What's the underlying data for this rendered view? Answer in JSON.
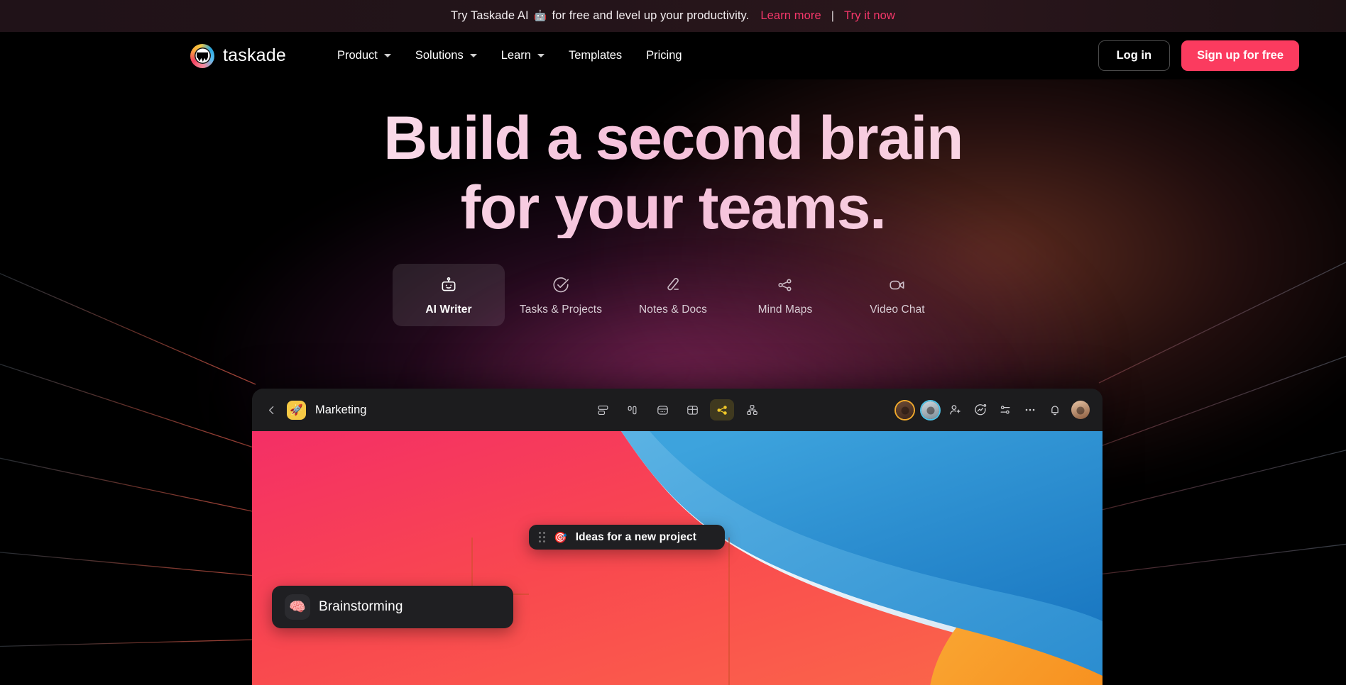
{
  "banner": {
    "text_before": "Try Taskade AI",
    "emoji": "🤖",
    "text_after": "for free and level up your productivity.",
    "learn_more": "Learn more",
    "separator": "|",
    "try_now": "Try it now",
    "link_color": "#f5376a"
  },
  "nav": {
    "brand": "taskade",
    "links": [
      {
        "label": "Product",
        "has_caret": true
      },
      {
        "label": "Solutions",
        "has_caret": true
      },
      {
        "label": "Learn",
        "has_caret": true
      },
      {
        "label": "Templates",
        "has_caret": false
      },
      {
        "label": "Pricing",
        "has_caret": false
      }
    ],
    "login_label": "Log in",
    "signup_label": "Sign up for free",
    "signup_color": "#fb3b5f"
  },
  "hero": {
    "headline_line1": "Build a second brain",
    "headline_line2": "for your teams.",
    "tabs": [
      {
        "label": "AI Writer",
        "icon": "robot-icon",
        "active": true
      },
      {
        "label": "Tasks & Projects",
        "icon": "check-circle-icon",
        "active": false
      },
      {
        "label": "Notes & Docs",
        "icon": "pen-icon",
        "active": false
      },
      {
        "label": "Mind Maps",
        "icon": "share-nodes-icon",
        "active": false
      },
      {
        "label": "Video Chat",
        "icon": "video-camera-icon",
        "active": false
      }
    ]
  },
  "app": {
    "project_emoji": "🚀",
    "project_name": "Marketing",
    "view_buttons": [
      {
        "name": "list-view",
        "active": false
      },
      {
        "name": "board-view",
        "active": false
      },
      {
        "name": "action-view",
        "active": false
      },
      {
        "name": "table-view",
        "active": false
      },
      {
        "name": "mindmap-view",
        "active": true
      },
      {
        "name": "org-chart-view",
        "active": false
      }
    ],
    "active_view_color": "#f0c828",
    "right_actions": [
      {
        "name": "collaborator-avatar-1"
      },
      {
        "name": "collaborator-avatar-2"
      },
      {
        "name": "invite-user-icon"
      },
      {
        "name": "activity-icon"
      },
      {
        "name": "filter-icon"
      },
      {
        "name": "more-options-icon"
      },
      {
        "name": "notifications-bell-icon"
      },
      {
        "name": "account-avatar"
      }
    ],
    "nodes": [
      {
        "emoji": "🎯",
        "text": "Ideas for a new project"
      },
      {
        "emoji": "🧠",
        "text": "Brainstorming"
      }
    ]
  }
}
